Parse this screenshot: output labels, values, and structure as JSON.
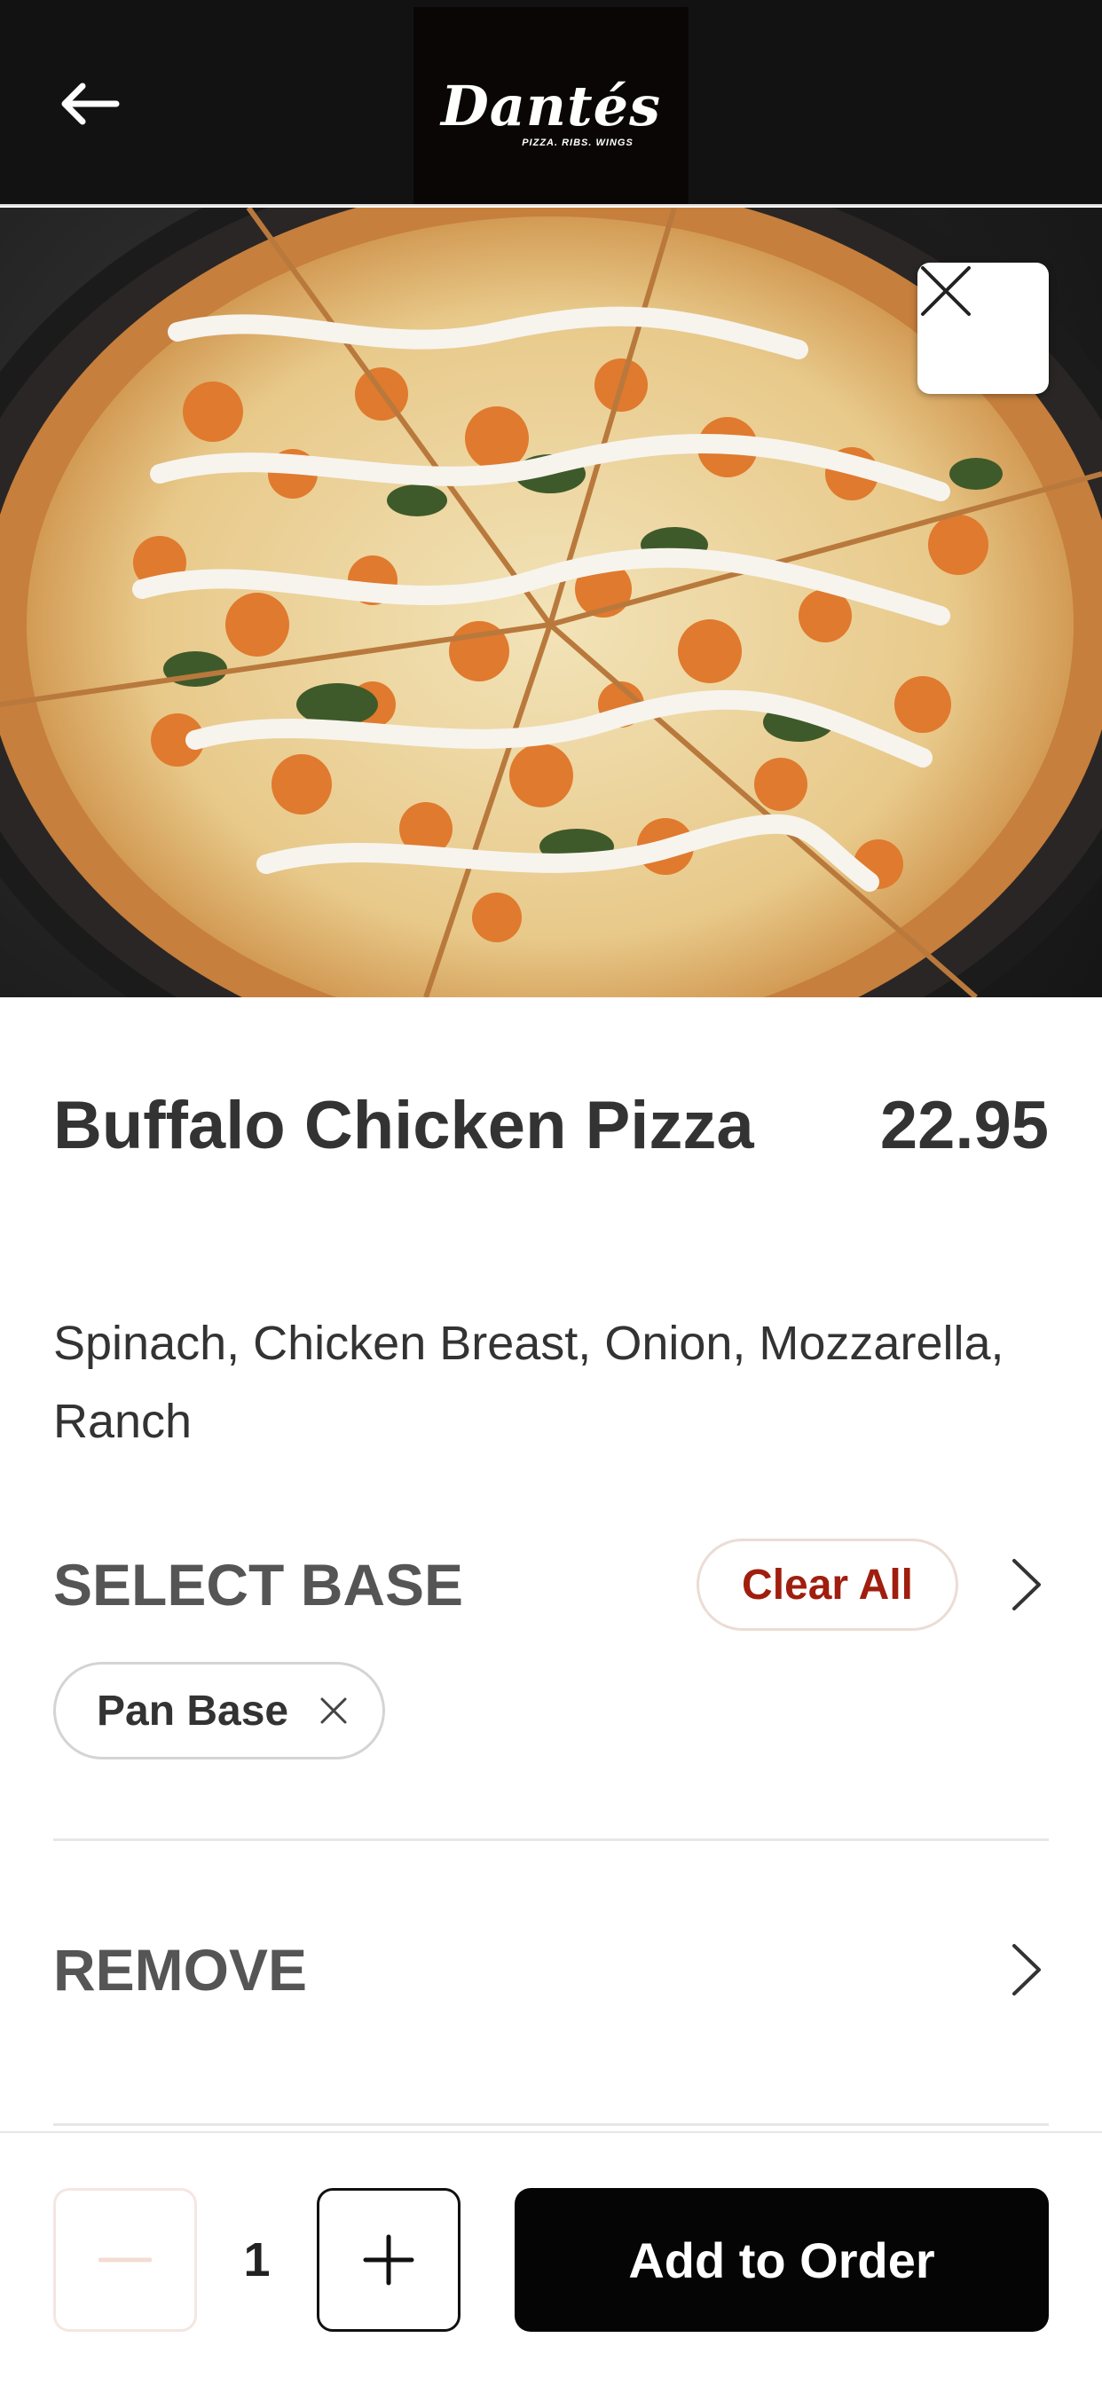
{
  "header": {
    "back_icon": "arrow-left-icon",
    "logo": {
      "wordmark": "Dantés",
      "tagline": "PIZZA. RIBS. WINGS"
    }
  },
  "hero": {
    "image": "buffalo-chicken-pizza-photo",
    "close_icon": "close-icon"
  },
  "item": {
    "name": "Buffalo Chicken Pizza",
    "price": "22.95",
    "description": "Spinach, Chicken Breast, Onion, Mozzarella, Ranch"
  },
  "sections": {
    "select_base": {
      "title": "SELECT BASE",
      "clear_label": "Clear All",
      "selected": [
        {
          "label": "Pan Base",
          "remove_icon": "close-icon"
        }
      ]
    },
    "remove": {
      "title": "REMOVE"
    }
  },
  "footer": {
    "quantity": "1",
    "minus_icon": "minus-icon",
    "plus_icon": "plus-icon",
    "add_label": "Add to Order"
  },
  "colors": {
    "header_bg": "#121212",
    "accent_red": "#a01e0e",
    "button_black": "#050505"
  }
}
